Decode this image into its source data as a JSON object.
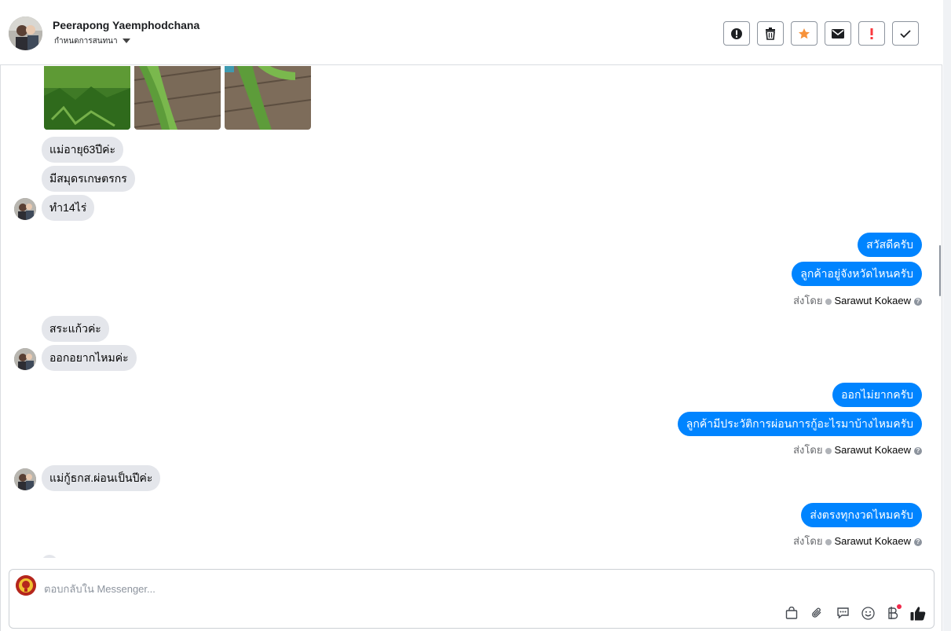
{
  "header": {
    "contact_name": "Peerapong Yaemphodchana",
    "assign_label": "กำหนดการสนทนา",
    "actions": [
      "mark-spam-icon",
      "trash-icon",
      "star-icon",
      "envelope-icon",
      "follow-up-icon",
      "done-check-icon"
    ]
  },
  "colors": {
    "accent": "#0084ff",
    "incoming_bubble": "#e4e6eb",
    "star": "#f7923a",
    "follow_up": "#fa383e"
  },
  "messages": {
    "in1": "แม่อายุ63ปีค่ะ",
    "in2": "มีสมุดรเกษตรกร",
    "in3": "ทำ14ไร่",
    "out1": "สวัสดีครับ",
    "out2": "ลูกค้าอยู่จังหวัดไหนครับ",
    "in4": "สระแก้วค่ะ",
    "in5": "ออกอยากไหมค่ะ",
    "out3": "ออกไม่ยากครับ",
    "out4": "ลูกค้ามีประวัติการผ่อนการกู้อะไรมาบ้างไหมครับ",
    "in6": "แม่กู้ธกส.ผ่อนเป็นปีค่ะ",
    "out5": "ส่งตรงทุกงวดไหมครับ"
  },
  "sent_by": {
    "label": "ส่งโดย",
    "sender": "Sarawut Kokaew",
    "help": "?"
  },
  "composer": {
    "placeholder": "ตอบกลับใน Messenger...",
    "tools": [
      "shopping-bag-icon",
      "paperclip-icon",
      "saved-replies-icon",
      "emoji-icon",
      "baht-payment-icon",
      "thumbs-up-icon"
    ]
  }
}
